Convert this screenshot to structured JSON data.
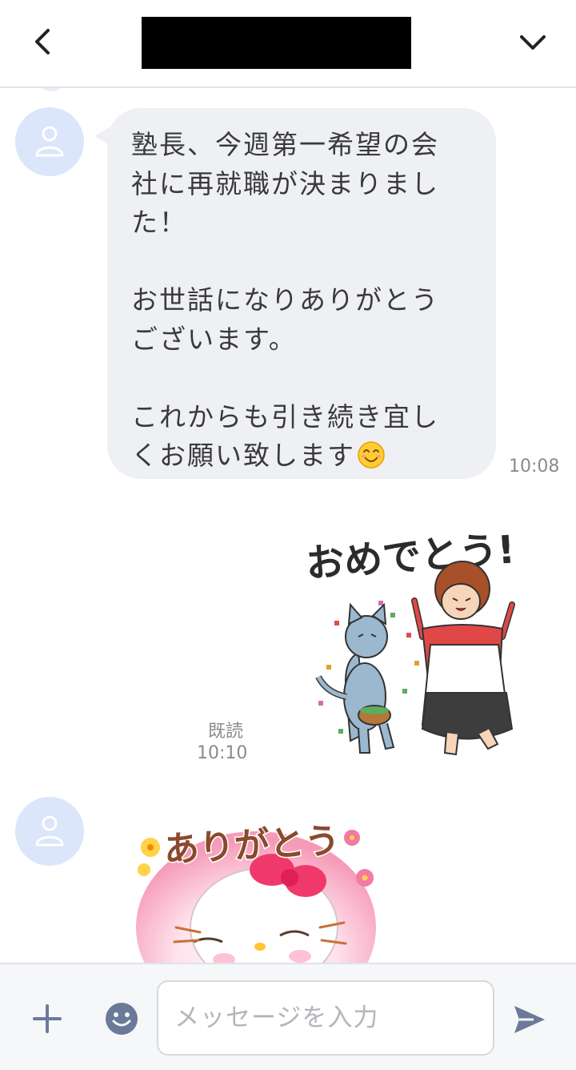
{
  "header": {
    "title": "",
    "back_icon": "chevron-left-icon",
    "menu_icon": "chevron-down-icon"
  },
  "messages": [
    {
      "sender": "other",
      "type": "text",
      "text": "塾長、今週第一希望の会\n社に再就職が決まりまし\nた！\n\nお世話になりありがとう\nございます。\n\nこれからも引き続き宜し\nくお願い致します",
      "emoji": "smiling-face-icon",
      "time": "10:08"
    },
    {
      "sender": "self",
      "type": "sticker",
      "sticker_text": "おめでとう!",
      "read_label": "既読",
      "time": "10:10"
    },
    {
      "sender": "other",
      "type": "sticker",
      "sticker_text": "ありがとう"
    }
  ],
  "input": {
    "placeholder": "メッセージを入力",
    "plus_icon": "plus-icon",
    "emoji_icon": "emoji-icon",
    "send_icon": "send-icon"
  },
  "colors": {
    "bubble": "#eef0f4",
    "avatar": "#dbe6fa",
    "accent": "#6b7a99"
  }
}
